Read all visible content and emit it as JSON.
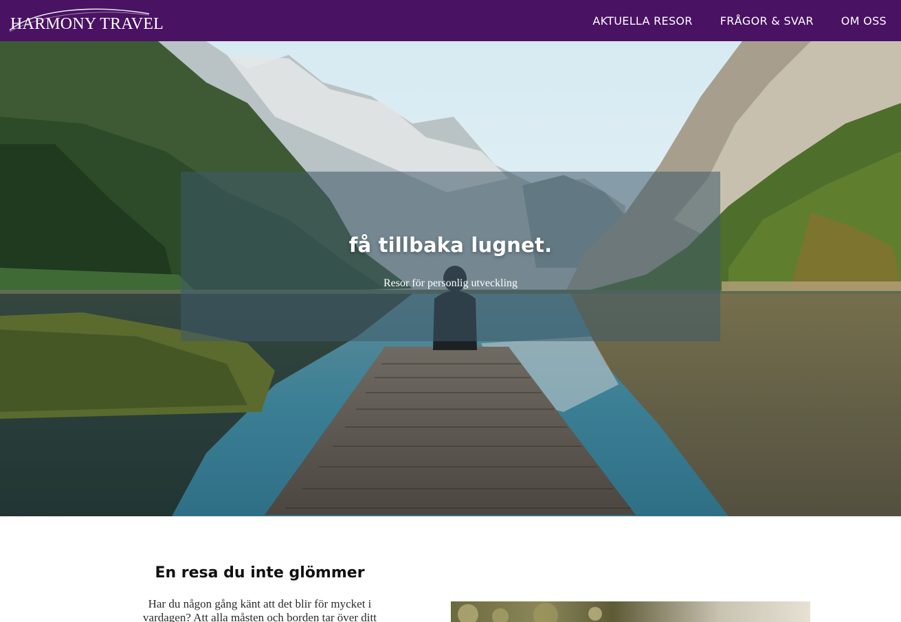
{
  "header": {
    "logo_text": "HARMONY TRAVEL",
    "background": "#491262",
    "nav": [
      {
        "label": "AKTUELLA RESOR"
      },
      {
        "label": "FRÅGOR & SVAR"
      },
      {
        "label": "OM OSS"
      }
    ]
  },
  "hero": {
    "title": "få tillbaka lugnet.",
    "subtitle": "Resor för personlig utveckling"
  },
  "intro": {
    "heading": "En resa du inte glömmer",
    "text": "Har du någon gång känt att det blir för mycket i vardagen? Att alla måsten och borden tar över ditt"
  }
}
